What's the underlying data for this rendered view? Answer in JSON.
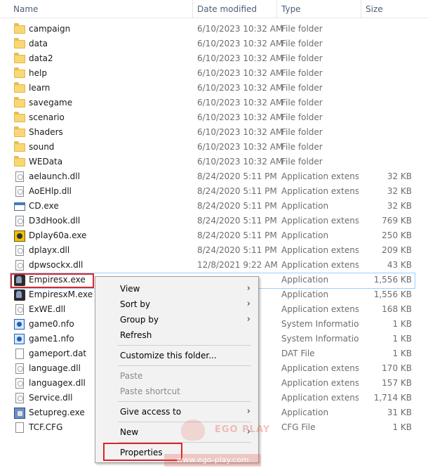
{
  "columns": {
    "name": "Name",
    "date": "Date modified",
    "type": "Type",
    "size": "Size"
  },
  "files": [
    {
      "name": "campaign",
      "date": "6/10/2023 10:32 AM",
      "type": "File folder",
      "size": "",
      "icon": "folder-icon"
    },
    {
      "name": "data",
      "date": "6/10/2023 10:32 AM",
      "type": "File folder",
      "size": "",
      "icon": "folder-icon"
    },
    {
      "name": "data2",
      "date": "6/10/2023 10:32 AM",
      "type": "File folder",
      "size": "",
      "icon": "folder-icon"
    },
    {
      "name": "help",
      "date": "6/10/2023 10:32 AM",
      "type": "File folder",
      "size": "",
      "icon": "folder-icon"
    },
    {
      "name": "learn",
      "date": "6/10/2023 10:32 AM",
      "type": "File folder",
      "size": "",
      "icon": "folder-icon"
    },
    {
      "name": "savegame",
      "date": "6/10/2023 10:32 AM",
      "type": "File folder",
      "size": "",
      "icon": "folder-icon"
    },
    {
      "name": "scenario",
      "date": "6/10/2023 10:32 AM",
      "type": "File folder",
      "size": "",
      "icon": "folder-icon"
    },
    {
      "name": "Shaders",
      "date": "6/10/2023 10:32 AM",
      "type": "File folder",
      "size": "",
      "icon": "folder-icon"
    },
    {
      "name": "sound",
      "date": "6/10/2023 10:32 AM",
      "type": "File folder",
      "size": "",
      "icon": "folder-icon"
    },
    {
      "name": "WEData",
      "date": "6/10/2023 10:32 AM",
      "type": "File folder",
      "size": "",
      "icon": "folder-icon"
    },
    {
      "name": "aelaunch.dll",
      "date": "8/24/2020 5:11 PM",
      "type": "Application extens...",
      "size": "32 KB",
      "icon": "dll-file-icon"
    },
    {
      "name": "AoEHlp.dll",
      "date": "8/24/2020 5:11 PM",
      "type": "Application extens...",
      "size": "32 KB",
      "icon": "dll-file-icon"
    },
    {
      "name": "CD.exe",
      "date": "8/24/2020 5:11 PM",
      "type": "Application",
      "size": "32 KB",
      "icon": "application-icon"
    },
    {
      "name": "D3dHook.dll",
      "date": "8/24/2020 5:11 PM",
      "type": "Application extens...",
      "size": "769 KB",
      "icon": "dll-file-icon"
    },
    {
      "name": "Dplay60a.exe",
      "date": "8/24/2020 5:11 PM",
      "type": "Application",
      "size": "250 KB",
      "icon": "dplay-app-icon"
    },
    {
      "name": "dplayx.dll",
      "date": "8/24/2020 5:11 PM",
      "type": "Application extens...",
      "size": "209 KB",
      "icon": "dll-file-icon"
    },
    {
      "name": "dpwsockx.dll",
      "date": "12/8/2021 9:22 AM",
      "type": "Application extens...",
      "size": "43 KB",
      "icon": "dll-file-icon"
    },
    {
      "name": "Empiresx.exe",
      "date": "",
      "type": "Application",
      "size": "1,556 KB",
      "icon": "game-app-icon"
    },
    {
      "name": "EmpiresxM.exe",
      "date": "AM",
      "type": "Application",
      "size": "1,556 KB",
      "icon": "game-app-icon"
    },
    {
      "name": "ExWE.dll",
      "date": "AM",
      "type": "Application extens...",
      "size": "168 KB",
      "icon": "dll-file-icon"
    },
    {
      "name": "game0.nfo",
      "date": "AM",
      "type": "System Informatio...",
      "size": "1 KB",
      "icon": "system-info-icon"
    },
    {
      "name": "game1.nfo",
      "date": "AM",
      "type": "System Informatio...",
      "size": "1 KB",
      "icon": "system-info-icon"
    },
    {
      "name": "gameport.dat",
      "date": "AM",
      "type": "DAT File",
      "size": "1 KB",
      "icon": "blank-file-icon"
    },
    {
      "name": "language.dll",
      "date": "AM",
      "type": "Application extens...",
      "size": "170 KB",
      "icon": "dll-file-icon"
    },
    {
      "name": "languagex.dll",
      "date": "AM",
      "type": "Application extens...",
      "size": "157 KB",
      "icon": "dll-file-icon"
    },
    {
      "name": "Service.dll",
      "date": "AM",
      "type": "Application extens...",
      "size": "1,714 KB",
      "icon": "dll-file-icon"
    },
    {
      "name": "Setupreg.exe",
      "date": "AM",
      "type": "Application",
      "size": "31 KB",
      "icon": "setup-app-icon"
    },
    {
      "name": "TCF.CFG",
      "date": "AM",
      "type": "CFG File",
      "size": "1 KB",
      "icon": "blank-file-icon"
    }
  ],
  "context_menu": {
    "view": "View",
    "sort_by": "Sort by",
    "group_by": "Group by",
    "refresh": "Refresh",
    "customize": "Customize this folder...",
    "paste": "Paste",
    "paste_shortcut": "Paste shortcut",
    "give_access": "Give access to",
    "new": "New",
    "properties": "Properties",
    "submenu_arrow": "›"
  },
  "watermark": {
    "brand": "EGO PLAY",
    "url": "www.ego-play.com"
  },
  "colors": {
    "highlight_border": "#d9262c",
    "selection_border": "#99d1ff",
    "menu_bg": "#f2f2f2"
  }
}
